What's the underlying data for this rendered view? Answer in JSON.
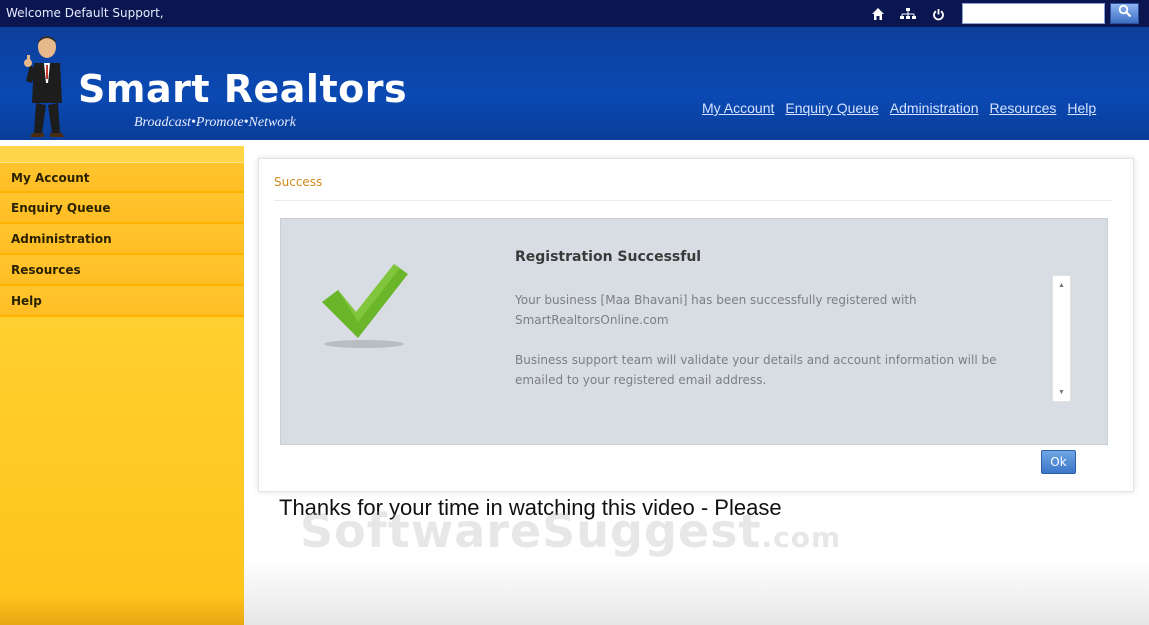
{
  "topbar": {
    "welcome": "Welcome Default Support,",
    "icons": [
      "home-icon",
      "sitemap-icon",
      "power-icon"
    ],
    "search": {
      "placeholder": "",
      "value": ""
    },
    "search_button_icon": "search-icon"
  },
  "header": {
    "brand": "Smart Realtors",
    "tagline": "Broadcast•Promote•Network",
    "nav": [
      "My Account",
      "Enquiry Queue",
      "Administration",
      "Resources",
      "Help"
    ]
  },
  "sidebar": {
    "items": [
      {
        "label": "My Account"
      },
      {
        "label": "Enquiry Queue"
      },
      {
        "label": "Administration"
      },
      {
        "label": "Resources"
      },
      {
        "label": "Help"
      }
    ]
  },
  "panel": {
    "title": "Success",
    "message": {
      "icon": "checkmark-icon",
      "title": "Registration Successful",
      "paragraph1": "Your business [Maa Bhavani] has been successfully registered with SmartRealtorsOnline.com",
      "paragraph2": "Business support team will validate your details and account information will be emailed to your registered email address."
    },
    "ok_label": "Ok"
  },
  "caption": "Thanks for your time in watching this video - Please",
  "watermark": {
    "main": "SoftwareSuggest",
    "suffix": ".com"
  },
  "colors": {
    "topbar": "#0b1550",
    "header": "#0a49b3",
    "sidebar": "#ffc52e",
    "panel_title": "#d18a1a",
    "message_box": "#d8dde3",
    "checkmark": "#6ab52a",
    "ok_button": "#3c76c7"
  }
}
